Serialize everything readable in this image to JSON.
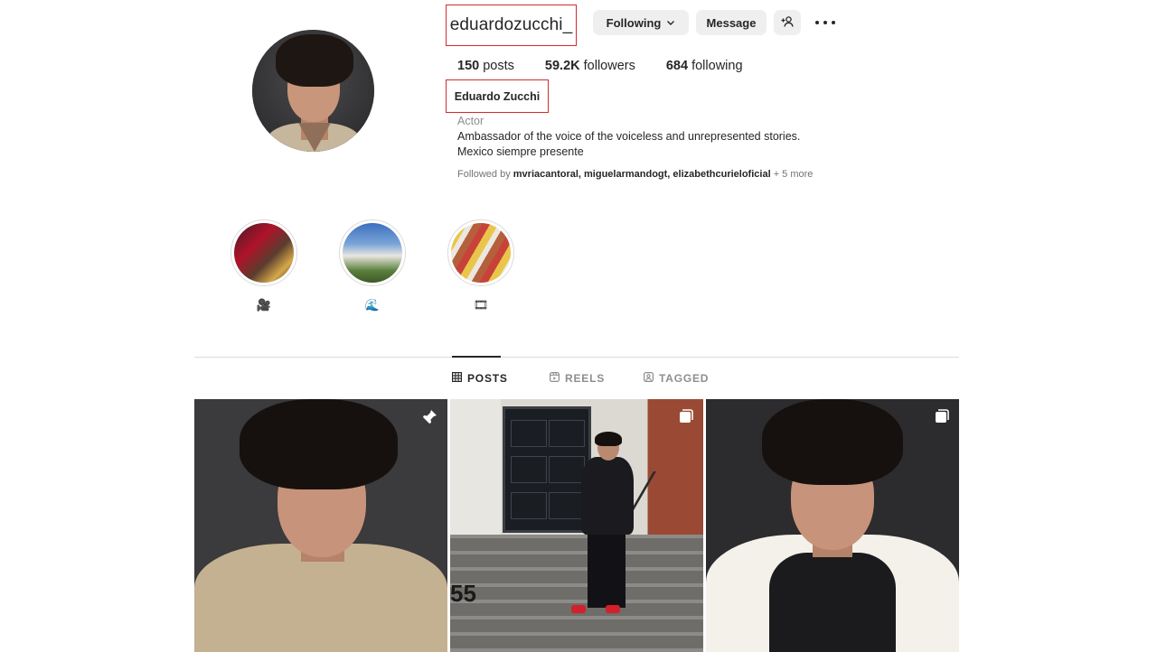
{
  "profile": {
    "username": "eduardozucchi_",
    "full_name": "Eduardo Zucchi",
    "category": "Actor",
    "bio_lines": [
      "Ambassador of the voice of the voiceless and unrepresented stories.",
      "Mexico siempre presente"
    ],
    "stats": {
      "posts_count": "150",
      "posts_label": "posts",
      "followers_count": "59.2K",
      "followers_label": "followers",
      "following_count": "684",
      "following_label": "following"
    },
    "followed_by": {
      "prefix": "Followed by",
      "names": "mvriacantoral, miguelarmandogt, elizabethcurieloficial",
      "suffix": "+ 5 more"
    }
  },
  "actions": {
    "following_label": "Following",
    "message_label": "Message",
    "add_user_icon": "add-user-icon",
    "more_icon": "more-options-icon"
  },
  "highlights": [
    {
      "label": "🎥",
      "icon": "highlight-cover-1"
    },
    {
      "label": "🌊",
      "icon": "highlight-cover-2"
    },
    {
      "label": "🎞",
      "icon": "highlight-cover-3"
    }
  ],
  "tabs": [
    {
      "label": "POSTS",
      "icon": "grid-icon",
      "active": true
    },
    {
      "label": "REELS",
      "icon": "reels-icon",
      "active": false
    },
    {
      "label": "TAGGED",
      "icon": "tagged-icon",
      "active": false
    }
  ],
  "posts": [
    {
      "badge": "pin-icon"
    },
    {
      "badge": "carousel-icon",
      "overlay_text": "55"
    },
    {
      "badge": "carousel-icon"
    }
  ],
  "colors": {
    "highlight_box": "#d22b2b",
    "button_bg": "#efefef",
    "text": "#262626",
    "muted": "#8e8e8e"
  }
}
